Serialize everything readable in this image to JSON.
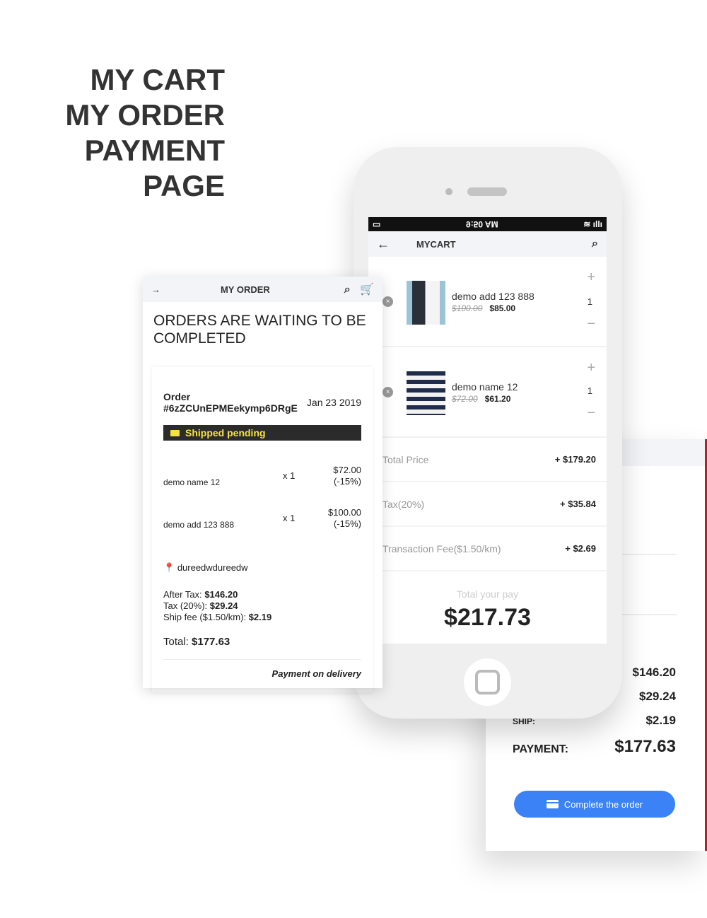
{
  "hero": {
    "lines": [
      "MY CART",
      "MY ORDER",
      "PAYMENT",
      "PAGE"
    ]
  },
  "payment": {
    "values": {
      "after_tax": "$146.20",
      "tax": "$29.24",
      "ship": "$2.19"
    },
    "ship_label": "SHIP:",
    "payment_label": "PAYMENT:",
    "payment_value": "$177.63",
    "complete_button": "Complete the order",
    "accent": "#3b82f6"
  },
  "cart": {
    "status_time": "9:50 AM",
    "title": "MYCART",
    "items": [
      {
        "name": "demo add 123 888",
        "old_price": "$100.00",
        "price": "$85.00",
        "qty": "1"
      },
      {
        "name": "demo name 12",
        "old_price": "$72.00",
        "price": "$61.20",
        "qty": "1"
      }
    ],
    "summary": [
      {
        "label": "Total Price",
        "value": "+ $179.20"
      },
      {
        "label": "Tax(20%)",
        "value": "+ $35.84"
      },
      {
        "label": "Transaction Fee($1.50/km)",
        "value": "+ $2.69"
      }
    ],
    "total_label": "Total your pay",
    "total_value": "$217.73"
  },
  "order": {
    "title": "MY ORDER",
    "heading": "ORDERS ARE WAITING TO BE COMPLETED",
    "order_label": "Order",
    "order_id": "#6zZCUnEPMEekymp6DRgE",
    "date": "Jan 23 2019",
    "status": "Shipped pending",
    "status_color": "#f5e33b",
    "lines": [
      {
        "name": "demo name 12",
        "qty": "x 1",
        "price": "$72.00",
        "discount": "(-15%)"
      },
      {
        "name": "demo add 123 888",
        "qty": "x 1",
        "price": "$100.00",
        "discount": "(-15%)"
      }
    ],
    "address": "dureedwdureedw",
    "after_tax_label": "After Tax:",
    "after_tax": "$146.20",
    "tax_label": "Tax (20%):",
    "tax": "$29.24",
    "ship_label": "Ship fee ($1.50/km):",
    "ship": "$2.19",
    "total_label": "Total:",
    "total": "$177.63",
    "payment_method": "Payment on delivery"
  }
}
